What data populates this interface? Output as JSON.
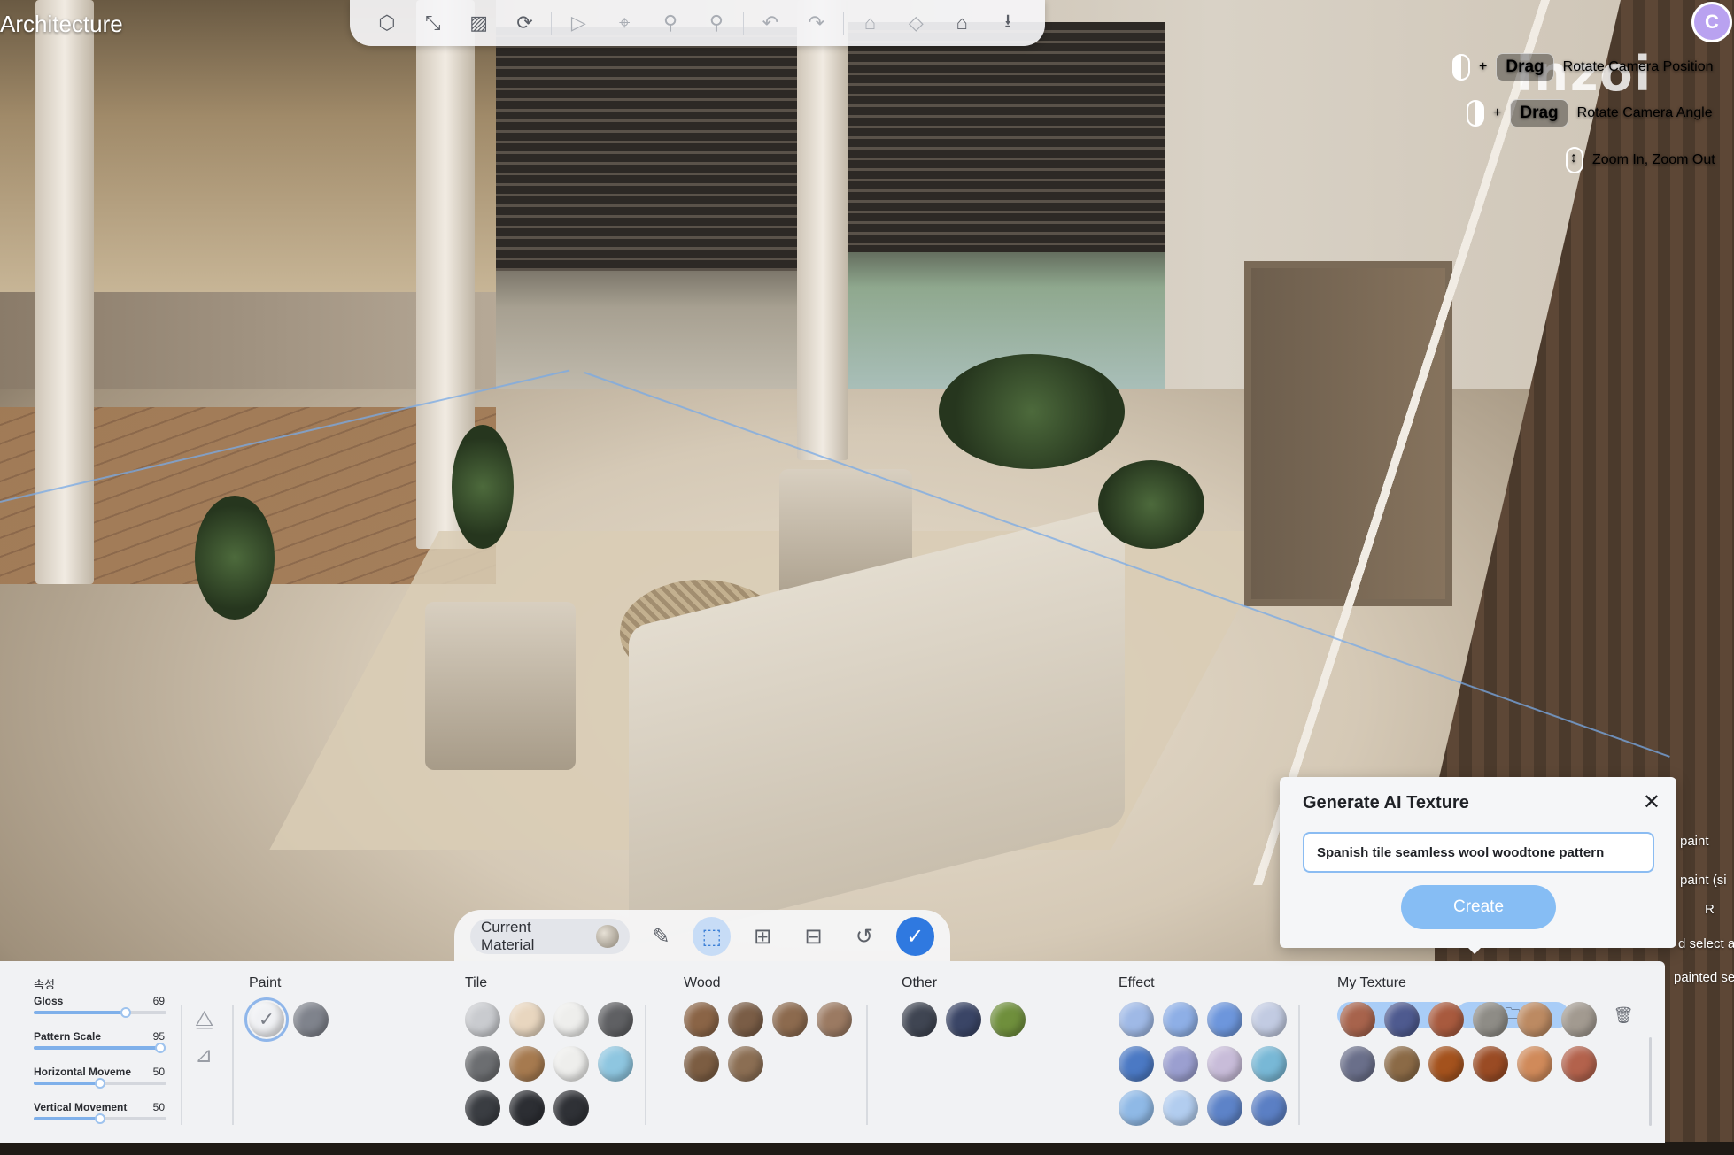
{
  "app": {
    "title": "Architecture",
    "logo_text": "inzoi",
    "avatar_initial": "C"
  },
  "top_toolbar": {
    "tools": [
      {
        "icon": "cube-icon",
        "glyph": "⬡",
        "dim": false
      },
      {
        "icon": "measure-icon",
        "glyph": "⤡",
        "dim": false
      },
      {
        "icon": "grid-pattern-icon",
        "glyph": "▨",
        "dim": false
      },
      {
        "icon": "magnet-icon",
        "glyph": "⟳",
        "dim": false
      },
      {
        "icon": "cursor-icon",
        "glyph": "▷",
        "dim": true
      },
      {
        "icon": "pin-icon",
        "glyph": "⌖",
        "dim": true
      },
      {
        "icon": "eyedropper-icon",
        "glyph": "⚲",
        "dim": true
      },
      {
        "icon": "brush-icon",
        "glyph": "⚲",
        "dim": true
      },
      {
        "icon": "undo-icon",
        "glyph": "↶",
        "dim": true
      },
      {
        "icon": "redo-icon",
        "glyph": "↷",
        "dim": true
      },
      {
        "icon": "house-icon",
        "glyph": "⌂",
        "dim": true
      },
      {
        "icon": "floor-plan-icon",
        "glyph": "◇",
        "dim": true
      },
      {
        "icon": "house-upload-icon",
        "glyph": "⌂",
        "dim": false
      },
      {
        "icon": "download-icon",
        "glyph": "⭳",
        "dim": false
      }
    ]
  },
  "camera_controls": [
    {
      "mouse": "left",
      "key": "Drag",
      "label": "Rotate Camera Position"
    },
    {
      "mouse": "right",
      "key": "Drag",
      "label": "Rotate Camera Angle"
    },
    {
      "mouse": "wheel",
      "key": "",
      "label": "Zoom In, Zoom Out"
    }
  ],
  "hints": [
    "paint",
    "paint (si",
    "R",
    "d select a",
    "painted sep"
  ],
  "tool_pill": {
    "current_material_label": "Current Material",
    "tools": [
      {
        "icon": "eyedropper-icon",
        "glyph": "✎",
        "state": "normal"
      },
      {
        "icon": "paint-area-icon",
        "glyph": "⬚",
        "state": "active"
      },
      {
        "icon": "select-add-icon",
        "glyph": "⊞",
        "state": "normal"
      },
      {
        "icon": "select-remove-icon",
        "glyph": "⊟",
        "state": "normal"
      },
      {
        "icon": "reset-icon",
        "glyph": "↺",
        "state": "normal"
      },
      {
        "icon": "confirm-icon",
        "glyph": "✓",
        "state": "confirm"
      }
    ]
  },
  "properties": {
    "title": "속성",
    "items": [
      {
        "name": "Gloss",
        "value": "69",
        "fraction": 0.69
      },
      {
        "name": "Pattern Scale",
        "value": "95",
        "fraction": 0.95
      },
      {
        "name": "Horizontal Moveme",
        "value": "50",
        "fraction": 0.5
      },
      {
        "name": "Vertical Movement",
        "value": "50",
        "fraction": 0.5
      }
    ]
  },
  "categories": {
    "paint": {
      "title": "Paint",
      "swatches": [
        "#f0f1f4",
        "#7f838c"
      ]
    },
    "tile": {
      "title": "Tile",
      "swatches": [
        "#c9cbcf",
        "#e8d6bf",
        "#eeeeec",
        "#5f6063",
        "#6c6e71",
        "#a67a4f",
        "#eeeeec",
        "#8ec6e0",
        "#3a3d42",
        "#2c2e33",
        "#2f3136"
      ]
    },
    "wood": {
      "title": "Wood",
      "swatches": [
        "#8a6446",
        "#7a5d46",
        "#8c6a4e",
        "#9b7a62",
        "#7c5d42",
        "#8b6e53"
      ]
    },
    "other": {
      "title": "Other",
      "swatches": [
        "#3f4552",
        "#3a4566",
        "#6f8f3c"
      ]
    },
    "effect": {
      "title": "Effect",
      "swatches": [
        "#9fb9e6",
        "#8eafe6",
        "#6d96dc",
        "#c2cbe2",
        "#4b79c4",
        "#9b9fd0",
        "#c8bcd9",
        "#78b8d6",
        "#8fb9e6",
        "#b2cdef",
        "#5d83c8",
        "#5b7fc4"
      ]
    },
    "my_texture": {
      "title": "My Texture",
      "swatches": [
        "#a7634c",
        "#4e5a8f",
        "#a85a3e",
        "#8e8c86",
        "#bc8a62",
        "#a29a90",
        "#6a6f8a",
        "#8b6a46",
        "#a4521d",
        "#9a4b24",
        "#d08a5a",
        "#b3624c"
      ]
    }
  },
  "ai_dialog": {
    "title": "Generate AI Texture",
    "input_value": "Spanish tile seamless wool woodtone pattern",
    "create_label": "Create"
  }
}
